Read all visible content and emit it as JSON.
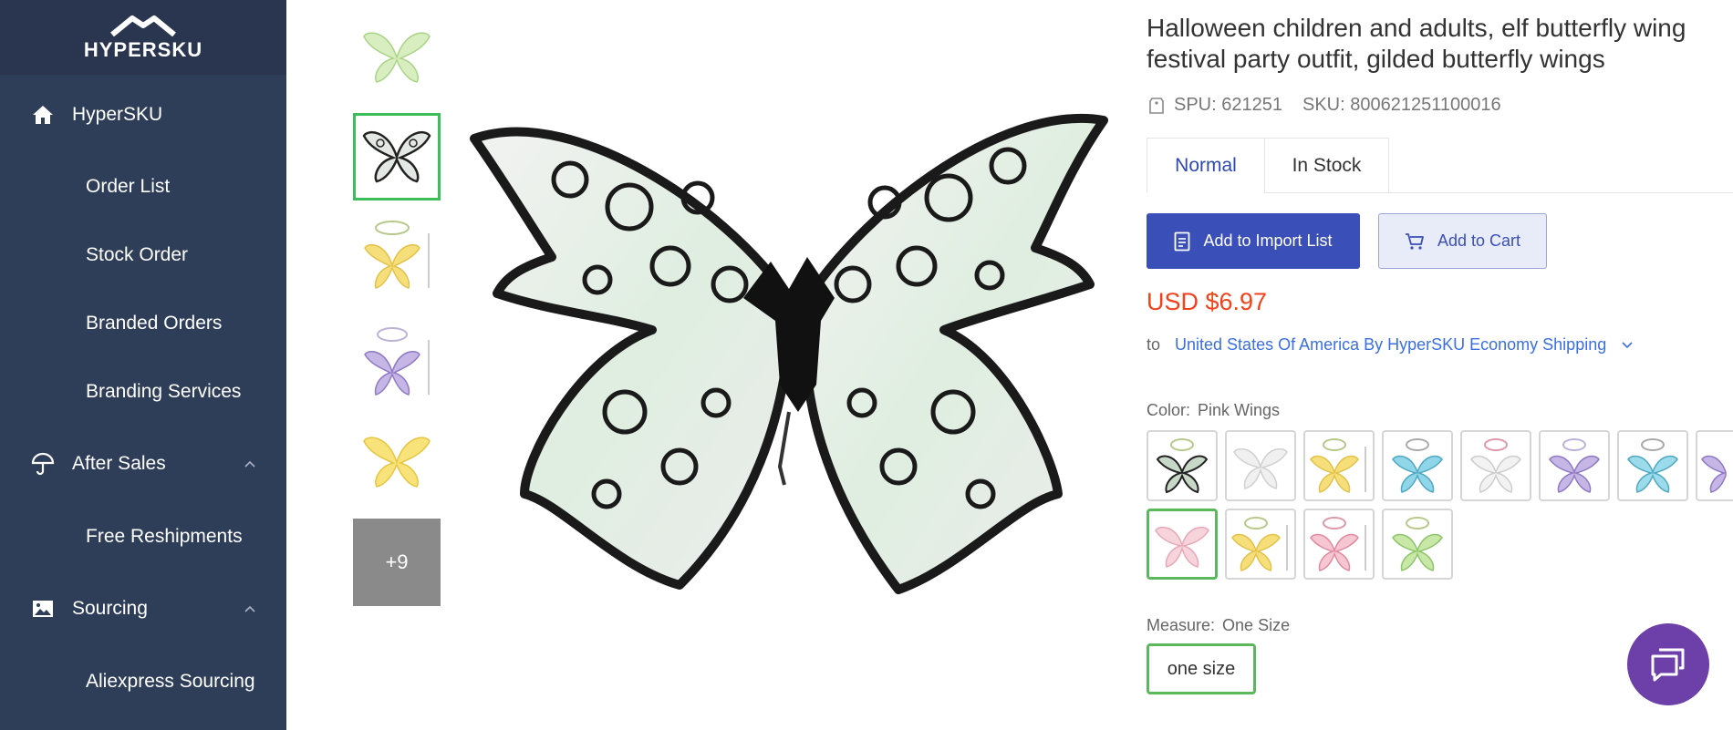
{
  "sidebar": {
    "logo_text": "HYPERSKU",
    "sections": [
      {
        "label": "HyperSKU",
        "icon": "home-icon"
      },
      {
        "label": "After Sales",
        "icon": "umbrella-icon"
      },
      {
        "label": "Sourcing",
        "icon": "image-icon"
      }
    ],
    "items": {
      "order_list": "Order List",
      "stock_order": "Stock Order",
      "branded_orders": "Branded Orders",
      "branding_services": "Branding Services",
      "free_reshipments": "Free Reshipments",
      "aliexpress_sourcing": "Aliexpress Sourcing"
    }
  },
  "gallery": {
    "thumbnails": [
      "green-butterfly-wings",
      "black-butterfly-wings",
      "yellow-wings-set",
      "purple-wings-set",
      "yellow-butterfly-wings"
    ],
    "selected_index": 1,
    "more_label": "+9"
  },
  "product": {
    "title_line1": "Halloween children and adults, elf butterfly wing",
    "title_line2": "festival party outfit, gilded butterfly wings",
    "spu": "SPU: 621251",
    "sku": "SKU: 800621251100016",
    "tabs": [
      "Normal",
      "In Stock"
    ],
    "active_tab": "Normal",
    "add_import_label": "Add to Import List",
    "add_cart_label": "Add to Cart",
    "price": "USD $6.97",
    "ship_to_label": "to",
    "ship_destination": "United States Of America By HyperSKU Economy Shipping",
    "color_label": "Color:",
    "color_value": "Pink Wings",
    "color_swatches": [
      "black-set",
      "white",
      "yellow-set",
      "cyan-set",
      "white-set",
      "purple-set",
      "cyan-set-2",
      "purple-partial",
      "pink",
      "yellow-set-2",
      "pink-set",
      "green-set"
    ],
    "selected_color_index": 8,
    "measure_label": "Measure:",
    "measure_value": "One Size",
    "size_option": "one size"
  },
  "colors": {
    "sidebar_bg": "#2f3e58",
    "primary": "#3b4fb8",
    "price": "#f0421b",
    "link": "#3b6fe0",
    "selected_border": "#5cb85c",
    "chat": "#6d3fa8"
  }
}
